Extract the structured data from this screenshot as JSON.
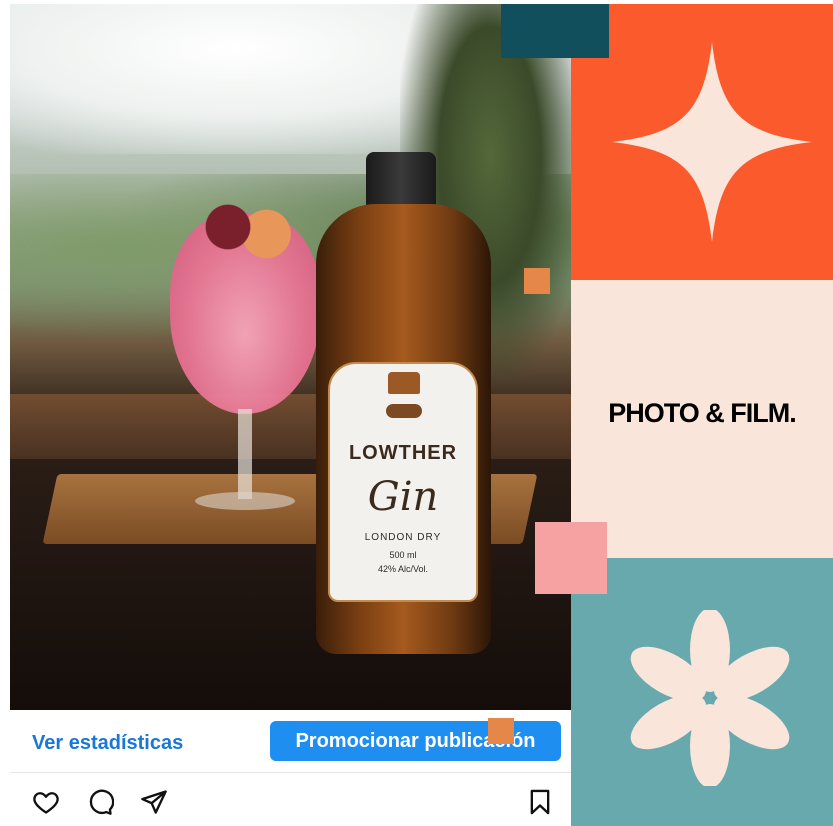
{
  "post": {
    "photo": {
      "label_brand": "LOWTHER",
      "label_product": "Gin",
      "label_style": "LONDON DRY",
      "label_volume": "500 ml",
      "label_abv": "42% Alc/Vol."
    },
    "actions": {
      "stats_label": "Ver estadísticas",
      "promote_label": "Promocionar publicación"
    },
    "icons": [
      "heart-icon",
      "comment-icon",
      "share-icon",
      "bookmark-icon"
    ]
  },
  "panel": {
    "tagline": "PHOTO & FILM."
  },
  "colors": {
    "accent_blue": "#1e8ff0",
    "link_blue": "#1877d8",
    "orange": "#fb5a2c",
    "cream": "#f9e5d9",
    "teal": "#68a9ae",
    "dark_teal": "#114f5c",
    "pink": "#f7a2a2"
  }
}
